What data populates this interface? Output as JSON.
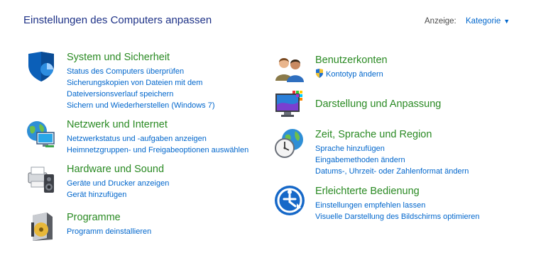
{
  "header": {
    "title": "Einstellungen des Computers anpassen",
    "view_label": "Anzeige:",
    "view_value": "Kategorie"
  },
  "left": [
    {
      "title": "System und Sicherheit",
      "icon": "security-shield-icon",
      "links": [
        "Status des Computers überprüfen",
        "Sicherungskopien von Dateien mit dem Dateiversionsverlauf speichern",
        "Sichern und Wiederherstellen (Windows 7)"
      ]
    },
    {
      "title": "Netzwerk und Internet",
      "icon": "network-globe-icon",
      "links": [
        "Netzwerkstatus und -aufgaben anzeigen",
        "Heimnetzgruppen- und Freigabeoptionen auswählen"
      ]
    },
    {
      "title": "Hardware und Sound",
      "icon": "printer-speaker-icon",
      "links": [
        "Geräte und Drucker anzeigen",
        "Gerät hinzufügen"
      ]
    },
    {
      "title": "Programme",
      "icon": "programs-disk-icon",
      "links": [
        "Programm deinstallieren"
      ]
    }
  ],
  "right": [
    {
      "title": "Benutzerkonten",
      "icon": "users-icon",
      "links": [
        "Kontotyp ändern"
      ]
    },
    {
      "title": "Darstellung und Anpassung",
      "icon": "monitor-palette-icon",
      "links": []
    },
    {
      "title": "Zeit, Sprache und Region",
      "icon": "clock-globe-icon",
      "links": [
        "Sprache hinzufügen",
        "Eingabemethoden ändern",
        "Datums-, Uhrzeit- oder Zahlenformat ändern"
      ]
    },
    {
      "title": "Erleichterte Bedienung",
      "icon": "accessibility-icon",
      "links": [
        "Einstellungen empfehlen lassen",
        "Visuelle Darstellung des Bildschirms optimieren"
      ]
    }
  ]
}
